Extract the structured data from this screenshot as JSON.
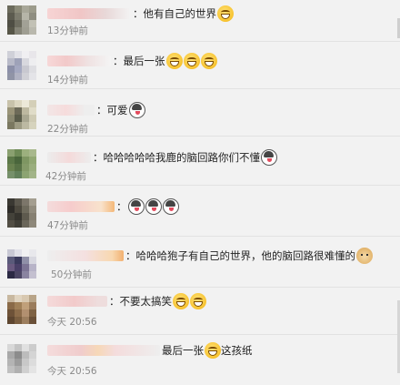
{
  "comments": [
    {
      "text": "：他有自己的世界",
      "emojis": [
        "laugh"
      ],
      "time": "13分钟前"
    },
    {
      "text": "：最后一张",
      "emojis": [
        "laugh",
        "laugh",
        "laugh"
      ],
      "time": "14分钟前"
    },
    {
      "text": "：可爱",
      "emojis": [
        "husky"
      ],
      "time": "22分钟前"
    },
    {
      "text": "：哈哈哈哈哈我鹿的脑回路你们不懂",
      "emojis": [
        "husky"
      ],
      "time": "42分钟前"
    },
    {
      "text": "：",
      "emojis": [
        "husky",
        "husky",
        "husky"
      ],
      "time": "47分钟前"
    },
    {
      "text": "：哈哈哈狍子有自己的世界，他的脑回路很难懂的",
      "emojis": [
        "doge"
      ],
      "time": "50分钟前"
    },
    {
      "text": "：不要太搞笑",
      "emojis": [
        "laugh",
        "laugh"
      ],
      "time": "今天 20:56"
    },
    {
      "text": "最后一张",
      "text_after": "这孩纸",
      "emojis": [
        "laugh"
      ],
      "time": "今天 20:56"
    }
  ]
}
